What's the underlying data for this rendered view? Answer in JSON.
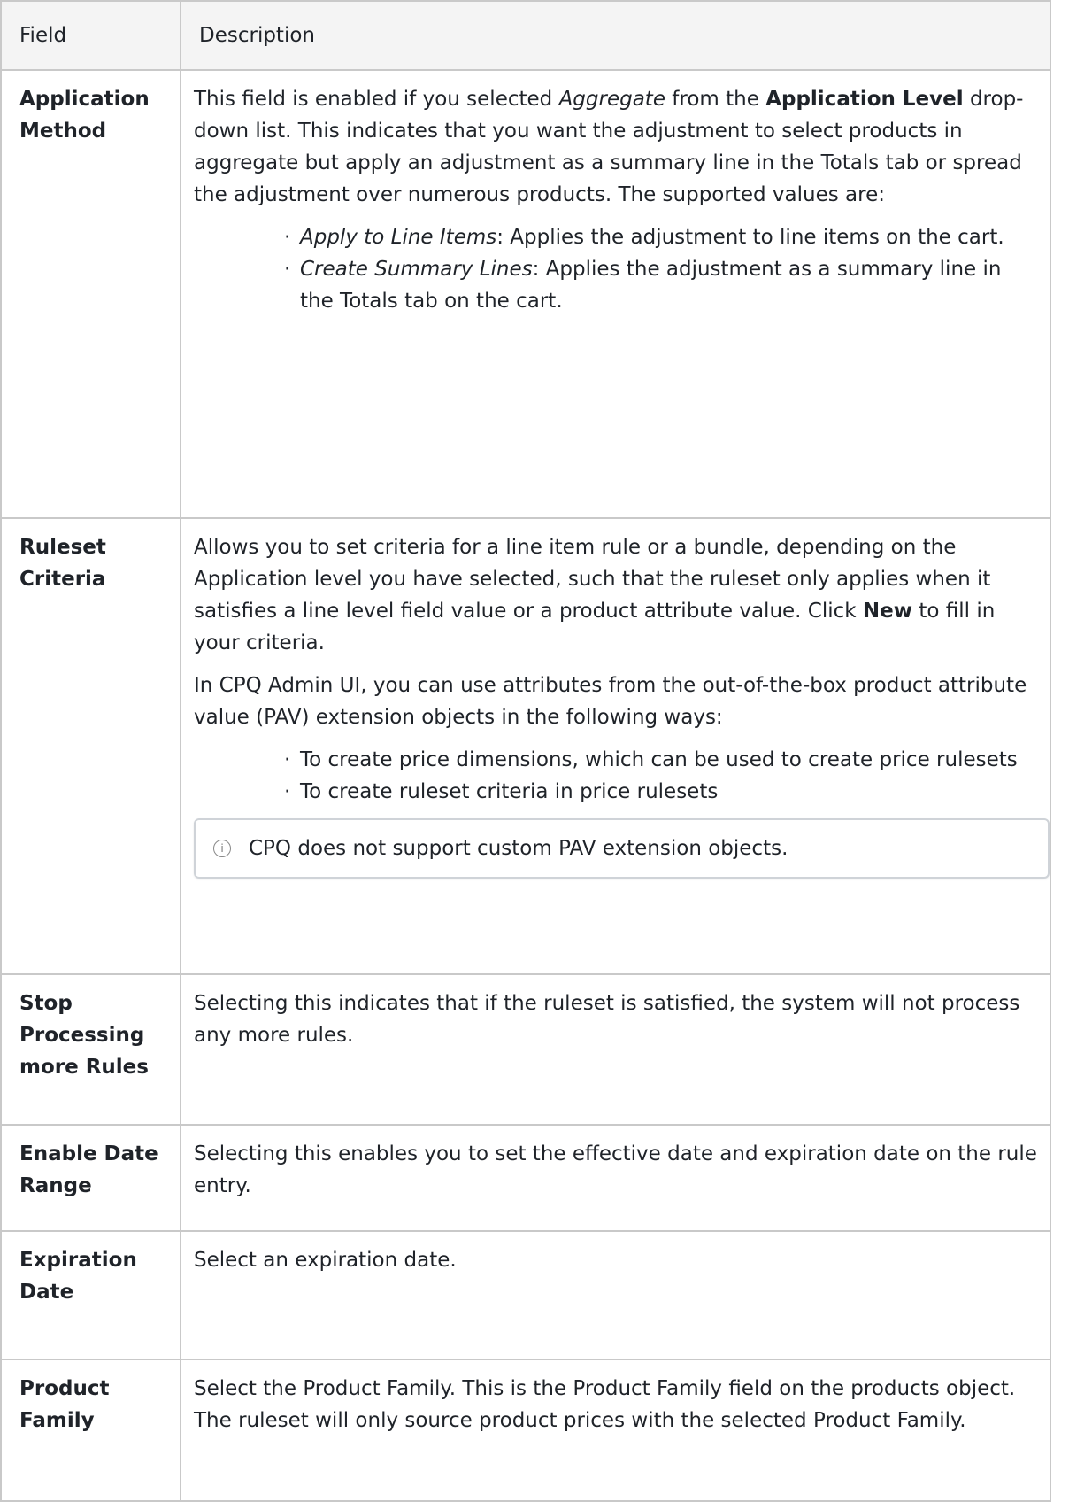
{
  "headers": {
    "field": "Field",
    "description": "Description"
  },
  "rows": [
    {
      "field": "Application Method",
      "p1_a": "This field is enabled if you selected ",
      "p1_i": "Aggregate",
      "p1_b": " from the ",
      "p1_bold": "Application Level",
      "p1_c": " drop-down list. This indicates that you want the adjustment to select products in aggregate but apply an adjustment as a summary line in the Totals tab or spread the adjustment over numerous products. The supported values are:",
      "items": [
        {
          "term": "Apply to Line Items",
          "text": ": Applies the adjustment to line items on the cart."
        },
        {
          "term": "Create Summary Lines",
          "text": ": Applies the adjustment as a summary line in the Totals tab on the cart."
        }
      ]
    },
    {
      "field": "Ruleset Criteria",
      "p1_a": "Allows you to set criteria for a line item rule or a bundle, depending on the Application level you have selected, such that the ruleset only applies when it satisfies a line level field value or a product attribute value. Click ",
      "p1_bold": "New",
      "p1_c": " to fill in your criteria.",
      "p2": "In CPQ Admin UI, you can use attributes from the out-of-the-box product attribute value (PAV) extension objects in the following ways:",
      "items": [
        "To create price dimensions, which can be used to create price rulesets",
        "To create ruleset criteria in price rulesets"
      ],
      "note_icon": "info-icon",
      "note": "CPQ does not support custom PAV extension objects."
    },
    {
      "field": "Stop Processing more Rules",
      "desc": "Selecting this indicates that if the ruleset is satisfied, the system will not process any more rules."
    },
    {
      "field": "Enable Date Range",
      "desc": "Selecting this enables you to set the effective date and expiration date on the rule entry."
    },
    {
      "field": "Expiration Date",
      "desc": "Select an expiration date."
    },
    {
      "field": "Product Family",
      "desc": "Select the Product Family. This is the Product Family field on the products object. The ruleset will only source product prices with the selected Product Family."
    }
  ]
}
